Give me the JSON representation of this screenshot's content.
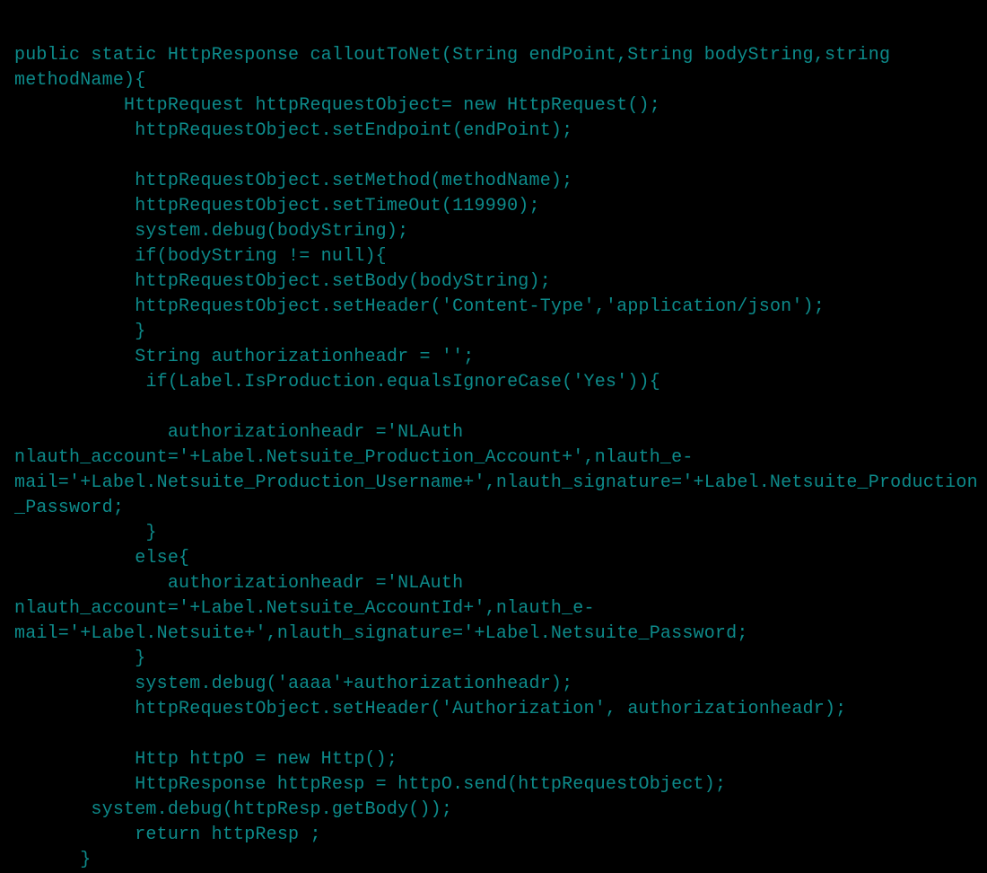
{
  "code": {
    "lines": [
      "public static HttpResponse calloutToNet(String endPoint,String bodyString,string methodName){",
      "          HttpRequest httpRequestObject= new HttpRequest();",
      "           httpRequestObject.setEndpoint(endPoint);",
      "",
      "           httpRequestObject.setMethod(methodName);",
      "           httpRequestObject.setTimeOut(119990);",
      "           system.debug(bodyString);",
      "           if(bodyString != null){",
      "           httpRequestObject.setBody(bodyString);",
      "           httpRequestObject.setHeader('Content-Type','application/json');",
      "           }",
      "           String authorizationheadr = '';",
      "            if(Label.IsProduction.equalsIgnoreCase('Yes')){",
      "",
      "              authorizationheadr ='NLAuth nlauth_account='+Label.Netsuite_Production_Account+',nlauth_e-mail='+Label.Netsuite_Production_Username+',nlauth_signature='+Label.Netsuite_Production_Password;",
      "            }",
      "           else{",
      "              authorizationheadr ='NLAuth nlauth_account='+Label.Netsuite_AccountId+',nlauth_e-mail='+Label.Netsuite+',nlauth_signature='+Label.Netsuite_Password;",
      "           }",
      "           system.debug('aaaa'+authorizationheadr);",
      "           httpRequestObject.setHeader('Authorization', authorizationheadr);",
      "",
      "           Http httpO = new Http();",
      "           HttpResponse httpResp = httpO.send(httpRequestObject);",
      "       system.debug(httpResp.getBody());",
      "           return httpResp ;",
      "      }"
    ]
  }
}
